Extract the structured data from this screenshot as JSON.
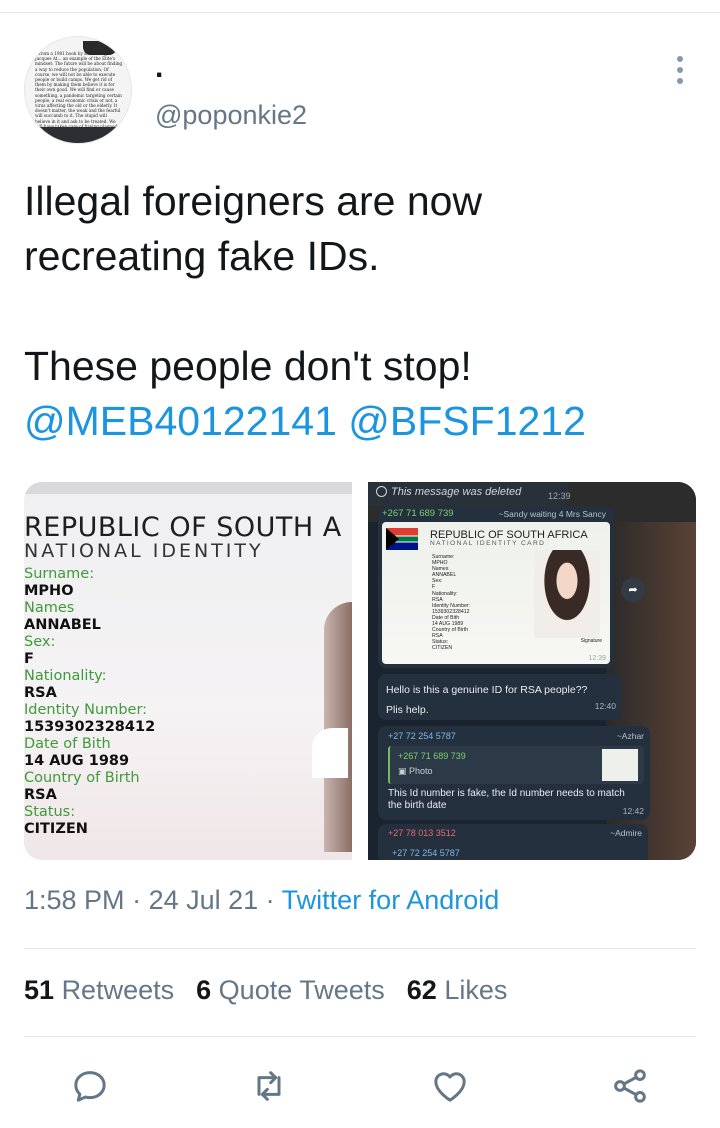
{
  "user": {
    "display_name": ".",
    "handle": "@poponkie2",
    "avatar_text": "...from a 1981 book by Bilderberger Jacques At... an example of the Elite's mindset: The future will be about finding a way to reduce the population, Of course, we will not be able to execute people or build camps. We get rid of them by making them believe it is for their own good. We will find or cause something, a pandemic targeting certain people, a real economic crisis or not, a virus affecting the old or the elderly. It doesn't matter, the weak and the fearful will succumb to it. The stupid will believe in it and ask to be treated. We will have taken care of having planned the treatment, a treatment that will be the solution. The selection of idiots will therefore be done by itself: they will go to the slaughterhouse alone."
  },
  "tweet": {
    "line1": "Illegal foreigners are now",
    "line2": "recreating fake IDs.",
    "line3": "These people don't stop!",
    "mention1": "@MEB40122141",
    "mention2": "@BFSF1212"
  },
  "media_left": {
    "title": "REPUBLIC OF SOUTH A",
    "subtitle": "NATIONAL IDENTITY",
    "fields": [
      {
        "label": "Surname:",
        "value": "MPHO"
      },
      {
        "label": "Names",
        "value": "ANNABEL"
      },
      {
        "label": "Sex:",
        "value": "F"
      },
      {
        "label": "Nationality:",
        "value": "RSA"
      },
      {
        "label": "Identity Number:",
        "value": "1539302328412"
      },
      {
        "label": "Date of Bith",
        "value": "14 AUG 1989"
      },
      {
        "label": "Country of Birth",
        "value": "RSA"
      },
      {
        "label": "Status:",
        "value": "CITIZEN"
      }
    ]
  },
  "media_right": {
    "deleted_text": "This message was deleted",
    "deleted_time": "12:39",
    "card_phone": "+267 71 689 739",
    "card_sender": "~Sandy waiting 4 Mrs Sancy",
    "card_title": "REPUBLIC OF SOUTH AFRICA",
    "card_subtitle": "NATIONAL IDENTITY CARD",
    "card_fields": "Surname:\nMPHO\nNames\nANNABEL\nSex:\nF\nNationality:\nRSA\nIdentity Number:\n1539302328412\nDate of Bith\n14 AUG 1989\nCountry of Birth\nRSA\nStatus:\nCITIZEN",
    "card_signature": "Signature",
    "card_time": "12:39",
    "question_line1": "Hello is this a genuine ID for RSA people??",
    "question_line2": "Plis help.",
    "question_time": "12:40",
    "reply_phone": "+27 72 254 5787",
    "reply_sender": "~Azhar",
    "quote_phone": "+267 71 689 739",
    "quote_photo": "▣ Photo",
    "reply_text": "This Id number is fake, the Id number needs to match the birth date",
    "reply_time": "12:42",
    "last_phone": "+27 78 013 3512",
    "last_sender": "~Admire",
    "last_phone2": "+27 72 254 5787"
  },
  "meta": {
    "time": "1:58 PM",
    "sep1": " · ",
    "date": "24 Jul 21",
    "sep2": " · ",
    "source": "Twitter for Android"
  },
  "stats": {
    "retweets_count": "51",
    "retweets_label": "Retweets",
    "quotes_count": "6",
    "quotes_label": "Quote Tweets",
    "likes_count": "62",
    "likes_label": "Likes"
  },
  "colors": {
    "link": "#1b95e0",
    "secondary_text": "#657786",
    "primary_text": "#14171a",
    "divider": "#e1e8ed"
  },
  "icons": [
    "reply-icon",
    "retweet-icon",
    "like-icon",
    "share-icon",
    "more-icon"
  ]
}
